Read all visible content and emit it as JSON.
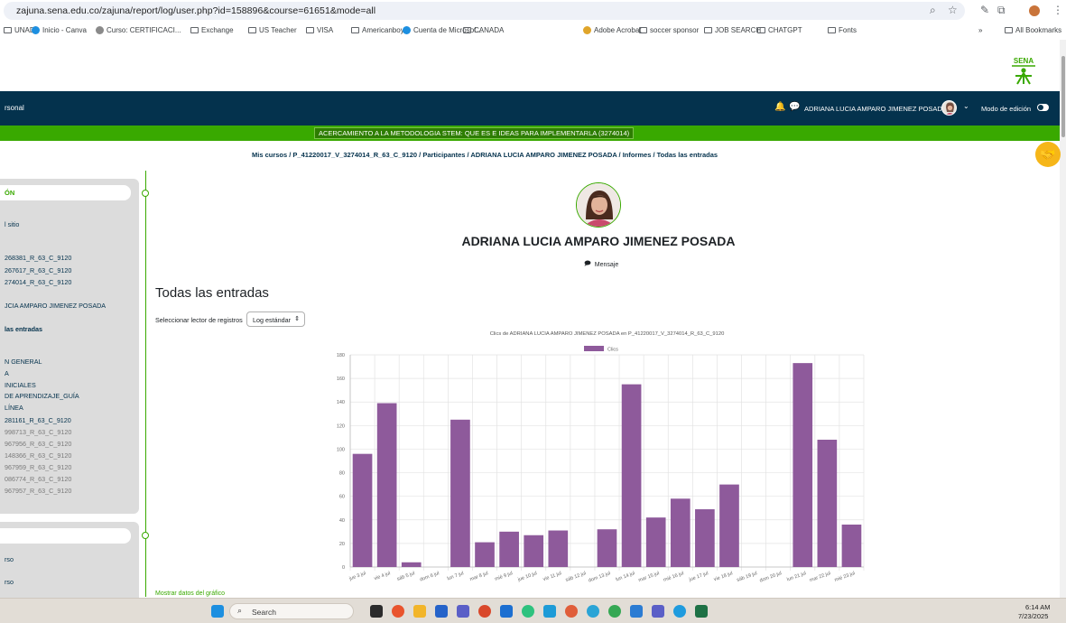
{
  "browser": {
    "url": "zajuna.sena.edu.co/zajuna/report/log/user.php?id=158896&course=61651&mode=all",
    "bookmarks": [
      "UNAD",
      "Inicio - Canva",
      "Curso: CERTIFICACI...",
      "Exchange",
      "US Teacher",
      "VISA",
      "Americanboys",
      "Cuenta de Microsof...",
      "CANADA",
      "Adobe Acrobat",
      "soccer sponsor",
      "JOB SEARCH",
      "CHATGPT",
      "Fonts"
    ],
    "more": "»",
    "all_bookmarks": "All Bookmarks"
  },
  "logo": {
    "text": "SENA"
  },
  "navbar": {
    "left_text": "rsonal",
    "user_name": "ADRIANA LUCIA AMPARO JIMENEZ POSADA",
    "edit_mode": "Modo de edición"
  },
  "course_banner": "ACERCAMIENTO A LA METODOLOGIA STEM: QUE ES E IDEAS PARA IMPLEMENTARLA (3274014)",
  "breadcrumb": "Mis cursos / P_41220017_V_3274014_R_63_C_9120 / Participantes / ADRIANA LUCIA AMPARO JIMENEZ POSADA / Informes / Todas las entradas",
  "drawer": {
    "header": "ÓN",
    "items": [
      {
        "label": "l sitio",
        "style": "normal"
      },
      {
        "label": "268381_R_63_C_9120",
        "style": "normal"
      },
      {
        "label": "267617_R_63_C_9120",
        "style": "normal"
      },
      {
        "label": "274014_R_63_C_9120",
        "style": "normal"
      },
      {
        "label": "JCIA AMPARO JIMENEZ POSADA",
        "style": "normal"
      },
      {
        "label": "las entradas",
        "style": "bold"
      },
      {
        "label": "N GENERAL",
        "style": "normal"
      },
      {
        "label": "A",
        "style": "normal"
      },
      {
        "label": "INICIALES",
        "style": "normal"
      },
      {
        "label": "DE APRENDIZAJE_GUÍA",
        "style": "normal"
      },
      {
        "label": "LÍNEA",
        "style": "normal"
      },
      {
        "label": "281161_R_63_C_9120",
        "style": "normal"
      },
      {
        "label": "998713_R_63_C_9120",
        "style": "grey"
      },
      {
        "label": "967956_R_63_C_9120",
        "style": "grey"
      },
      {
        "label": "148366_R_63_C_9120",
        "style": "grey"
      },
      {
        "label": "967959_R_63_C_9120",
        "style": "grey"
      },
      {
        "label": "086774_R_63_C_9120",
        "style": "grey"
      },
      {
        "label": "967957_R_63_C_9120",
        "style": "grey"
      }
    ],
    "items_2": [
      "rso",
      "rso"
    ]
  },
  "profile": {
    "name": "ADRIANA LUCIA AMPARO JIMENEZ POSADA",
    "message": "Mensaje"
  },
  "page": {
    "heading": "Todas las entradas",
    "reader_label": "Seleccionar lector de registros",
    "reader_value": "Log estándar",
    "show_data": "Mostrar datos del gráfico"
  },
  "chart_data": {
    "type": "bar",
    "title": "Clics de ADRIANA LUCIA AMPARO JIMENEZ POSADA  en P_41220017_V_3274014_R_63_C_9120",
    "legend": "Clics",
    "color": "#8e5a9b",
    "categories": [
      "jue 3 jul",
      "vie 4 jul",
      "sáb 5 jul",
      "dom 6 jul",
      "lun 7 jul",
      "mar 8 jul",
      "mié 9 jul",
      "jue 10 jul",
      "vie 11 jul",
      "sáb 12 jul",
      "dom 13 jul",
      "lun 14 jul",
      "mar 15 jul",
      "mié 16 jul",
      "jue 17 jul",
      "vie 18 jul",
      "sáb 19 jul",
      "dom 20 jul",
      "lun 21 jul",
      "mar 22 jul",
      "mié 23 jul"
    ],
    "values": [
      96,
      139,
      4,
      0,
      125,
      21,
      30,
      27,
      31,
      0,
      32,
      155,
      42,
      58,
      49,
      70,
      0,
      0,
      173,
      108,
      36
    ],
    "ylim": [
      0,
      180
    ],
    "yticks": [
      0,
      20,
      40,
      60,
      80,
      100,
      120,
      140,
      160,
      180
    ],
    "grid": true,
    "legend_position": "top"
  },
  "taskbar": {
    "search": "Search",
    "time": "6:14 AM",
    "date": "7/23/2025"
  }
}
